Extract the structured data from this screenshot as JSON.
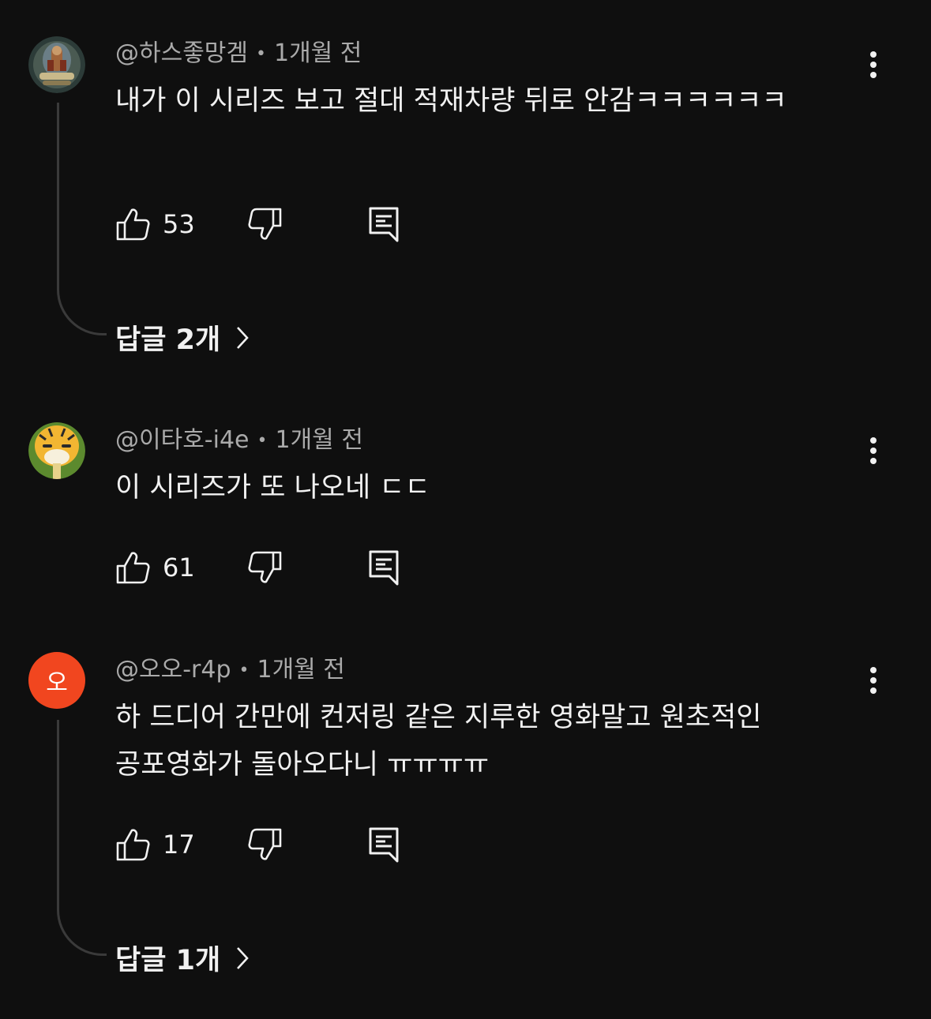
{
  "comments": [
    {
      "author": "@하스좋망겜",
      "separator": "•",
      "time": "1개월 전",
      "text": "내가 이 시리즈 보고 절대 적재차량 뒤로 안감ㅋㅋㅋㅋㅋㅋ",
      "likes": "53",
      "replies_label": "답글 2개"
    },
    {
      "author": "@이타호-i4e",
      "separator": "•",
      "time": "1개월 전",
      "text": "이 시리즈가 또 나오네 ㄷㄷ",
      "likes": "61"
    },
    {
      "author": "@오오-r4p",
      "separator": "•",
      "time": "1개월 전",
      "avatar_letter": "오",
      "avatar_color": "#f1461f",
      "text": "하 드디어 간만에 컨저링 같은 지루한 영화말고 원초적인 공포영화가 돌아오다니 ㅠㅠㅠㅠ",
      "likes": "17",
      "replies_label": "답글 1개"
    }
  ],
  "icons": {
    "like": "thumbs-up-icon",
    "dislike": "thumbs-down-icon",
    "reply": "reply-comment-icon",
    "more": "more-vertical-icon",
    "chevron": "chevron-right-icon"
  },
  "colors": {
    "background": "#0f0f0f",
    "text": "#f1f1f1",
    "meta": "#aaaaaa",
    "thread_line": "#3a3a3a"
  }
}
